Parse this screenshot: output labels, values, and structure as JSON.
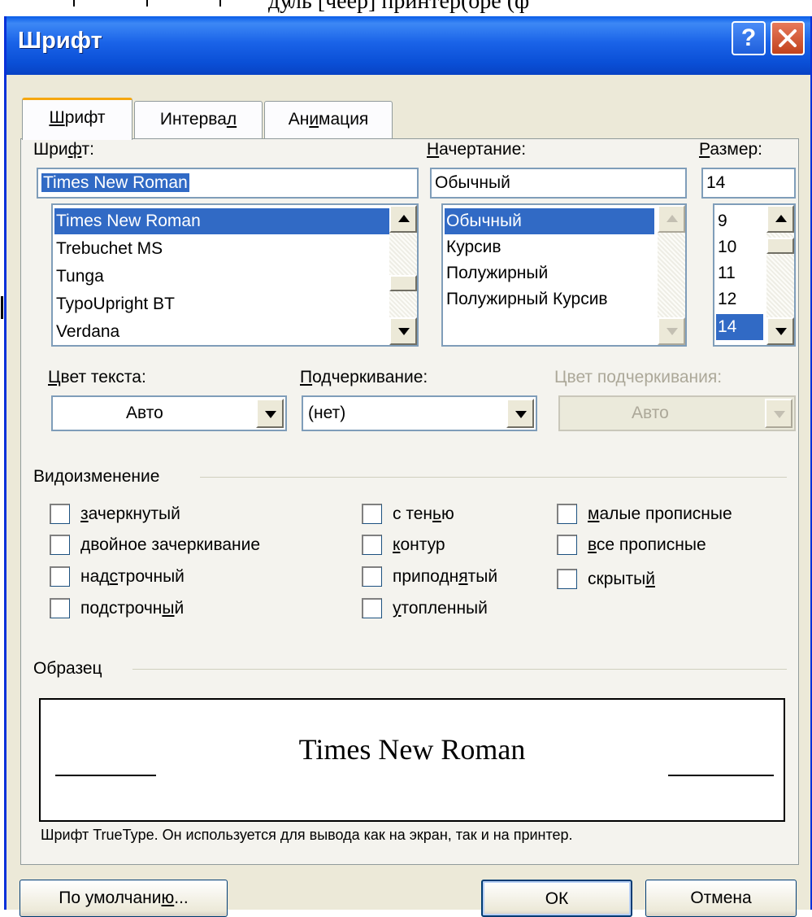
{
  "dialog": {
    "title": "Шрифт",
    "help_button": "?",
    "tabs": [
      {
        "label_before": "",
        "key": "Ш",
        "label_after": "рифт"
      },
      {
        "label_before": "Интерва",
        "key": "л",
        "label_after": ""
      },
      {
        "label_before": "Ан",
        "key": "и",
        "label_after": "мация"
      }
    ]
  },
  "font": {
    "label_before": "Шри",
    "label_key": "ф",
    "label_after": "т:",
    "value": "Times New Roman",
    "items": [
      "Times New Roman",
      "Trebuchet MS",
      "Tunga",
      "TypoUpright BT",
      "Verdana"
    ],
    "selected": "Times New Roman"
  },
  "style": {
    "label_before": "",
    "label_key": "Н",
    "label_after": "ачертание:",
    "value": "Обычный",
    "items": [
      "Обычный",
      "Курсив",
      "Полужирный",
      "Полужирный Курсив"
    ],
    "selected": "Обычный"
  },
  "size": {
    "label_before": "",
    "label_key": "Р",
    "label_after": "азмер:",
    "value": "14",
    "items": [
      "9",
      "10",
      "11",
      "12",
      "14"
    ],
    "selected": "14"
  },
  "text_color": {
    "label_before": "",
    "label_key": "Ц",
    "label_after": "вет текста:",
    "value": "Авто"
  },
  "underline": {
    "label_before": "",
    "label_key": "П",
    "label_after": "одчеркивание:",
    "value": "(нет)"
  },
  "underline_color": {
    "label": "Цвет подчеркивания:",
    "value": "Авто",
    "enabled": false
  },
  "effects": {
    "group_label": "Видоизменение",
    "items": [
      {
        "id": "strikethrough",
        "before": "",
        "key": "з",
        "after": "ачеркнутый",
        "checked": false
      },
      {
        "id": "double-strikethrough",
        "before": "",
        "key": "д",
        "after": "войное зачеркивание",
        "checked": false
      },
      {
        "id": "superscript",
        "before": "над",
        "key": "с",
        "after": "трочный",
        "checked": false
      },
      {
        "id": "subscript",
        "before": "подстрочн",
        "key": "ы",
        "after": "й",
        "checked": false
      },
      {
        "id": "shadow",
        "before": "с тен",
        "key": "ь",
        "after": "ю",
        "checked": false
      },
      {
        "id": "outline",
        "before": "",
        "key": "к",
        "after": "онтур",
        "checked": false
      },
      {
        "id": "emboss",
        "before": "приподн",
        "key": "я",
        "after": "тый",
        "checked": false
      },
      {
        "id": "engrave",
        "before": "",
        "key": "у",
        "after": "топленный",
        "checked": false
      },
      {
        "id": "small-caps",
        "before": "",
        "key": "м",
        "after": "алые прописные",
        "checked": false
      },
      {
        "id": "all-caps",
        "before": "",
        "key": "в",
        "after": "се прописные",
        "checked": false
      },
      {
        "id": "hidden",
        "before": "скрыты",
        "key": "й",
        "after": "",
        "checked": false
      }
    ]
  },
  "preview": {
    "group_label": "Образец",
    "text": "Times New Roman",
    "note": "Шрифт TrueType. Он используется для вывода как на экран, так и на принтер."
  },
  "buttons": {
    "default": {
      "before": "По умолчани",
      "key": "ю",
      "after": "..."
    },
    "ok": "ОК",
    "cancel": "Отмена"
  },
  "background_text": "дуль    [чеер]    принтер(оре     (ф"
}
